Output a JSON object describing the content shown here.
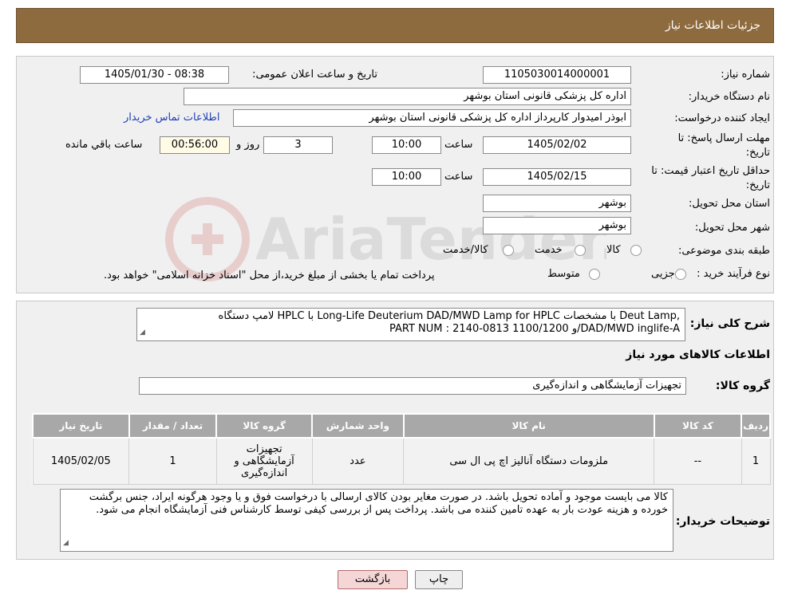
{
  "header": {
    "title": "جزئیات اطلاعات نیاز"
  },
  "form": {
    "need_number_label": "شماره نیاز:",
    "need_number": "1105030014000001",
    "announce_label": "تاریخ و ساعت اعلان عمومی:",
    "announce_value": "1405/01/30 - 08:38",
    "buyer_org_label": "نام دستگاه خریدار:",
    "buyer_org": "اداره کل پزشکی قانونی استان بوشهر",
    "requester_label": "ایجاد کننده درخواست:",
    "requester": "ابوذر امیدوار کارپرداز اداره کل پزشکی قانونی استان بوشهر",
    "contact_link": "اطلاعات تماس خریدار",
    "deadline_label_1": "مهلت ارسال پاسخ: تا",
    "deadline_label_2": "تاریخ:",
    "deadline_date": "1405/02/02",
    "time_label": "ساعت",
    "deadline_time": "10:00",
    "days_value": "3",
    "days_label": "روز و",
    "remaining_time": "00:56:00",
    "remaining_label": "ساعت باقي مانده",
    "validity_label_1": "حداقل تاریخ اعتبار قیمت: تا",
    "validity_label_2": "تاریخ:",
    "validity_date": "1405/02/15",
    "validity_time": "10:00",
    "province_label": "استان محل تحویل:",
    "province": "بوشهر",
    "city_label": "شهر محل تحویل:",
    "city": "بوشهر",
    "category_label": "طبقه بندی موضوعی:",
    "category_options": [
      "کالا",
      "خدمت",
      "کالا/خدمت"
    ],
    "purchase_type_label": "نوع فرآیند خرید :",
    "purchase_options": [
      "جزیی",
      "متوسط"
    ],
    "purchase_note": "پرداخت تمام یا بخشی از مبلغ خرید،از محل \"اسناد خزانه اسلامی\" خواهد بود."
  },
  "details": {
    "summary_label": "شرح کلی نیاز:",
    "summary_line1": "لامپ دستگاه HPLC با Long-Life Deuterium DAD/MWD Lamp for HPLC با مشخصات Deut Lamp,",
    "summary_line2": "PART NUM : 2140-0813 و 1100/1200/DAD/MWD inglife-A",
    "items_heading": "اطلاعات کالاهای مورد نیاز",
    "group_label": "گروه کالا:",
    "group_value": "تجهیزات آزمایشگاهی و اندازه‌گیری",
    "table": {
      "headers": [
        "ردیف",
        "کد کالا",
        "نام کالا",
        "واحد شمارش",
        "گروه کالا",
        "تعداد / مقدار",
        "تاریخ نیاز"
      ],
      "rows": [
        [
          "1",
          "--",
          "ملزومات دستگاه آنالیز اچ پی ال سی",
          "عدد",
          "تجهیزات آزمایشگاهی و اندازه‌گیری",
          "1",
          "1405/02/05"
        ]
      ]
    },
    "buyer_notes_label": "توضیحات خریدار:",
    "buyer_notes": "کالا می بایست موجود و آماده تحویل باشد. در صورت مغایر بودن کالای ارسالی با درخواست فوق و یا وجود هرگونه ایراد، جنس برگشت خورده و هزینه عودت بار به عهده تامین کننده می باشد. پرداخت پس از بررسی کیفی توسط کارشناس فنی آزمایشگاه انجام می شود."
  },
  "buttons": {
    "print": "چاپ",
    "back": "بازگشت"
  },
  "watermark": {
    "text": "AriaTender.neT"
  },
  "colors": {
    "header_bg": "#8e6b3e",
    "panel_bg": "#f0f0f0",
    "table_header_bg": "#a8a8a8",
    "link": "#1f3fb8"
  }
}
